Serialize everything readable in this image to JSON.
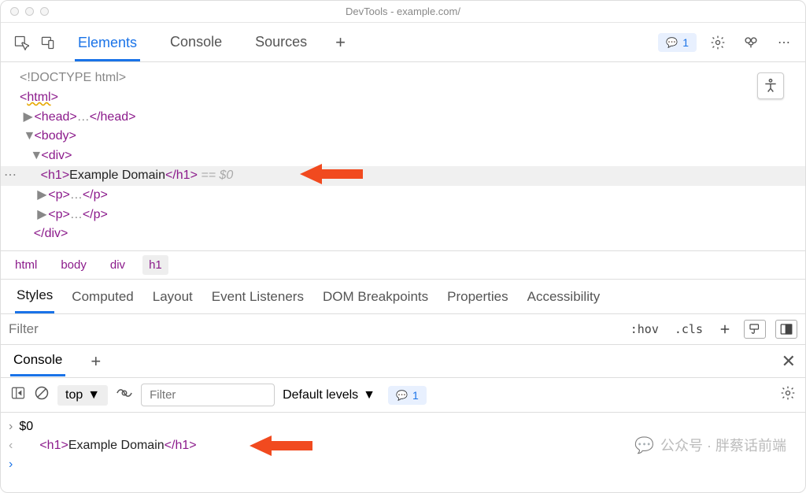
{
  "window": {
    "title": "DevTools - example.com/"
  },
  "tabs": {
    "elements": "Elements",
    "console": "Console",
    "sources": "Sources"
  },
  "issues": {
    "count": "1"
  },
  "dom": {
    "doctype": "<!DOCTYPE html>",
    "html_open": "html",
    "head": "head",
    "body": "body",
    "div": "div",
    "h1": "h1",
    "h1_text": "Example Domain",
    "p": "p",
    "eqvar": "== $0"
  },
  "breadcrumbs": [
    "html",
    "body",
    "div",
    "h1"
  ],
  "styles_tabs": [
    "Styles",
    "Computed",
    "Layout",
    "Event Listeners",
    "DOM Breakpoints",
    "Properties",
    "Accessibility"
  ],
  "filter": {
    "placeholder": "Filter",
    "hov": ":hov",
    "cls": ".cls"
  },
  "consoleDrawer": {
    "tab": "Console",
    "context": "top",
    "filter_placeholder": "Filter",
    "levels": "Default levels",
    "issues_count": "1",
    "rows": {
      "input": "$0",
      "out_h1": "h1",
      "out_text": "Example Domain"
    }
  },
  "watermark": "公众号 · 胖蔡话前端"
}
